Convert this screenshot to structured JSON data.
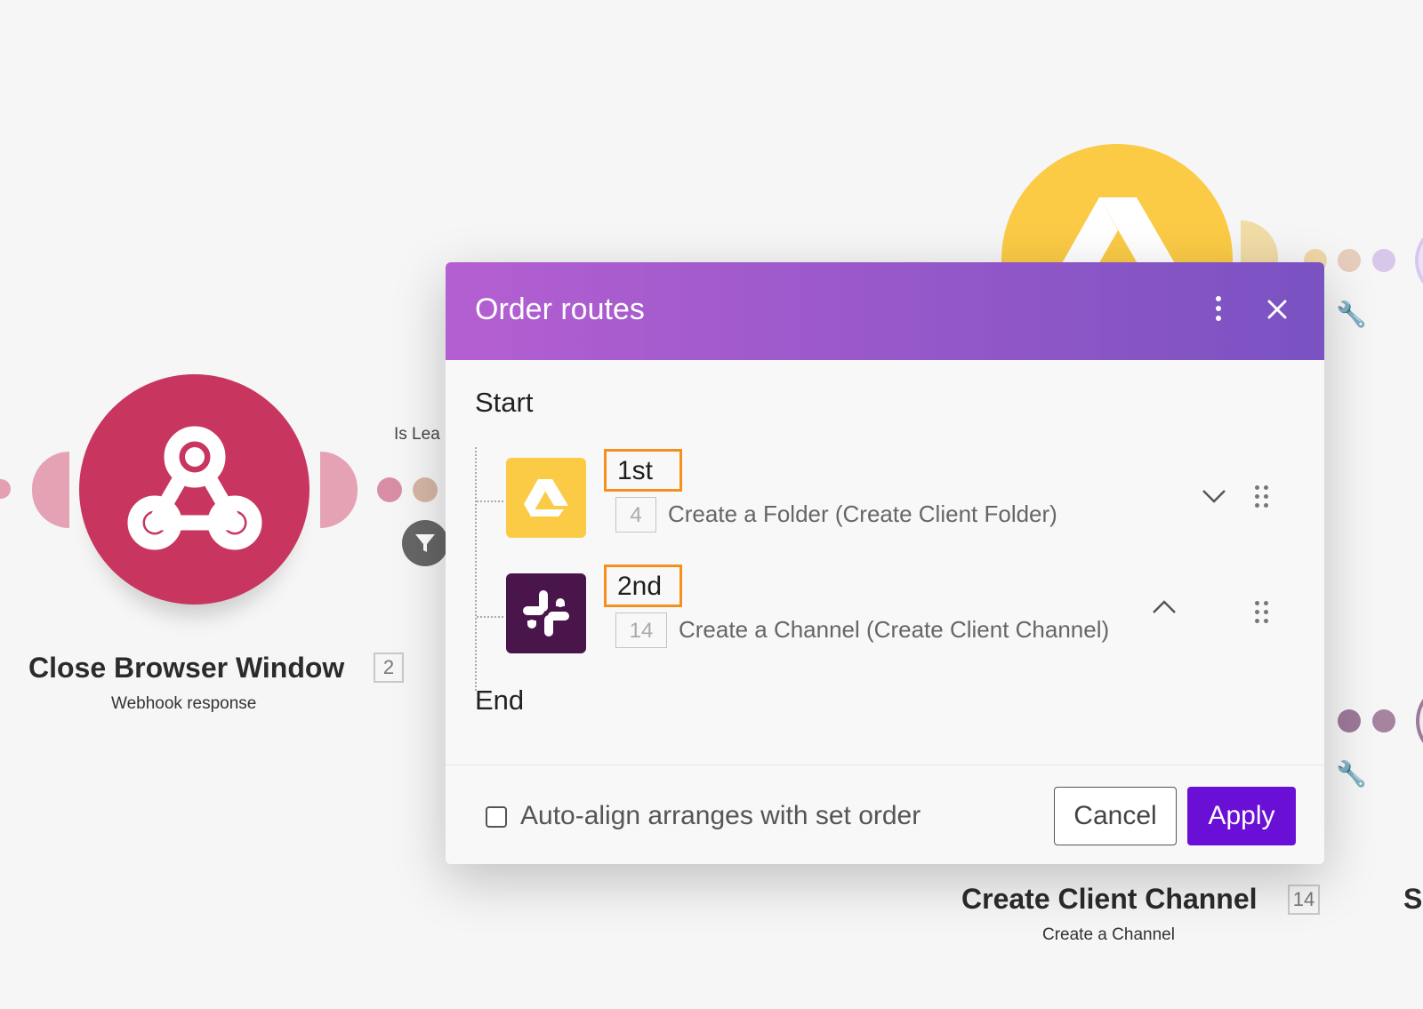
{
  "canvas": {
    "webhook_node": {
      "title": "Close Browser Window",
      "count": "2",
      "subtitle": "Webhook response",
      "icon": "webhook-icon",
      "color": "#c8365f"
    },
    "link_label": "Is Lea",
    "filter_icon": "filter-icon",
    "slack_node": {
      "title": "Create Client Channel",
      "count": "14",
      "subtitle": "Create a Channel"
    },
    "partial_node_title": "S",
    "drive_node_icon": "google-drive-icon",
    "wrench_icon": "wrench-icon"
  },
  "modal": {
    "title": "Order routes",
    "menu_icon": "more-vertical-icon",
    "close_icon": "close-icon",
    "start_label": "Start",
    "end_label": "End",
    "routes": [
      {
        "order": "1st",
        "module_number": "4",
        "text": "Create a Folder (Create Client Folder)",
        "app_icon": "google-drive-icon",
        "icon_bg": "#fbcb46",
        "toggle_icon": "chevron-down-icon"
      },
      {
        "order": "2nd",
        "module_number": "14",
        "text": "Create a Channel (Create Client Channel)",
        "app_icon": "slack-icon",
        "icon_bg": "#4a154b",
        "toggle_icon": "chevron-up-icon"
      }
    ],
    "footer": {
      "checkbox_label": "Auto-align arranges with set order",
      "cancel_label": "Cancel",
      "apply_label": "Apply",
      "apply_color": "#6a0fd6"
    }
  }
}
